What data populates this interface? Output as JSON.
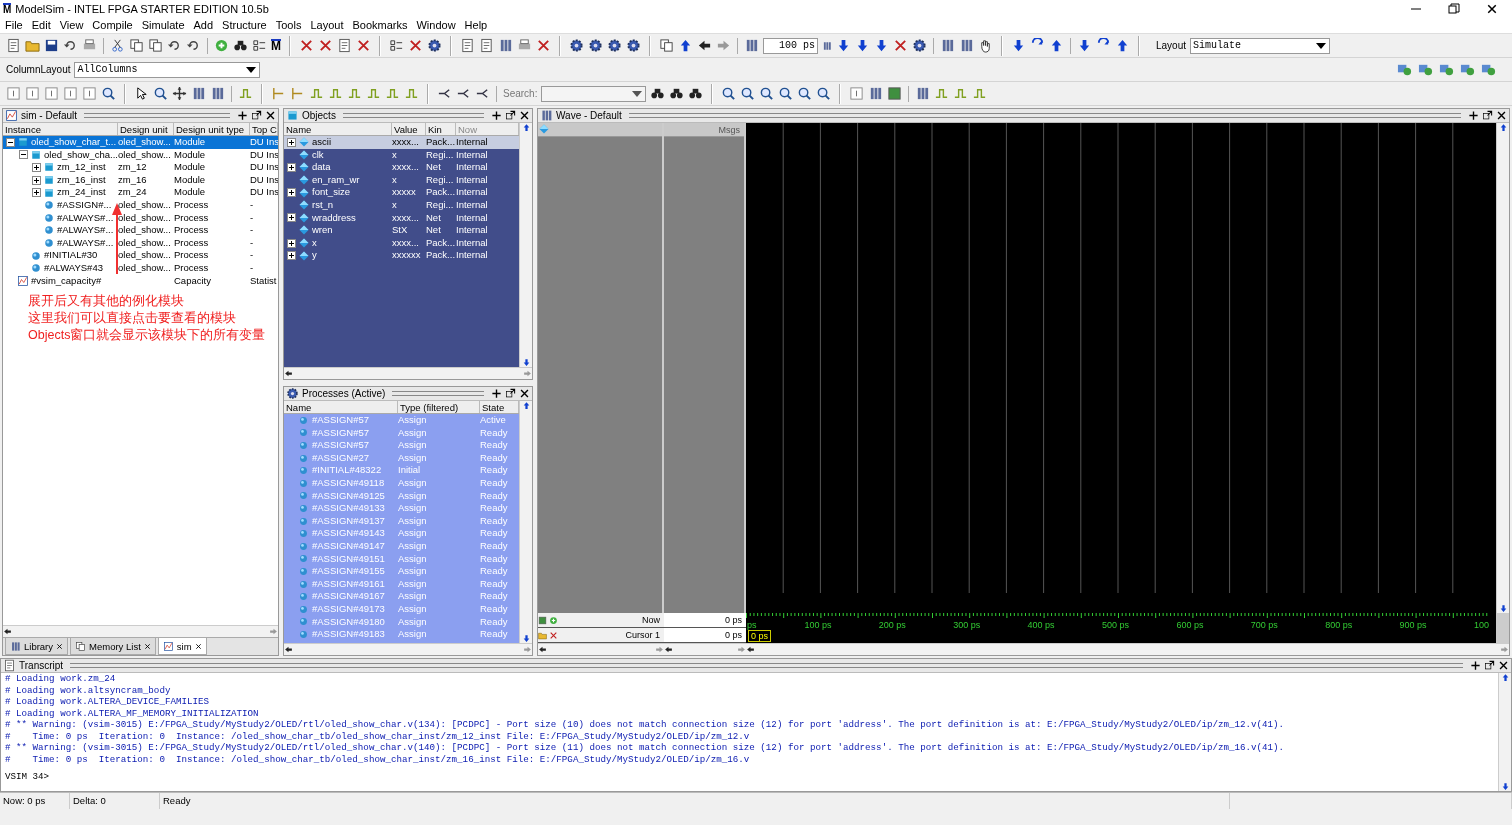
{
  "window": {
    "logo": "M",
    "title": "ModelSim - INTEL FPGA STARTER EDITION 10.5b"
  },
  "menu": [
    "File",
    "Edit",
    "View",
    "Compile",
    "Simulate",
    "Add",
    "Structure",
    "Tools",
    "Layout",
    "Bookmarks",
    "Window",
    "Help"
  ],
  "toolbar": {
    "logo": "M",
    "run_length": "100 ps",
    "layout_label": "Layout",
    "layout_value": "Simulate",
    "column_layout_label": "ColumnLayout",
    "column_layout_value": "AllColumns",
    "search_label": "Search:"
  },
  "sim": {
    "title": "sim - Default",
    "columns": [
      "Instance",
      "Design unit",
      "Design unit type",
      "Top C"
    ],
    "items": [
      {
        "kind": "module",
        "name": "oled_show_char_t...",
        "unit": "oled_show...",
        "type": "Module",
        "top": "DU Ins",
        "selected": true,
        "expanded": true,
        "children": [
          {
            "kind": "module",
            "name": "oled_show_cha...",
            "unit": "oled_show...",
            "type": "Module",
            "top": "DU Ins",
            "selected": false,
            "expanded": true,
            "children": [
              {
                "kind": "module",
                "name": "zm_12_inst",
                "unit": "zm_12",
                "type": "Module",
                "top": "DU Ins",
                "selected": false,
                "expanded": false
              },
              {
                "kind": "module",
                "name": "zm_16_inst",
                "unit": "zm_16",
                "type": "Module",
                "top": "DU Ins",
                "selected": false,
                "expanded": false
              },
              {
                "kind": "module",
                "name": "zm_24_inst",
                "unit": "zm_24",
                "type": "Module",
                "top": "DU Ins",
                "selected": false,
                "expanded": false
              },
              {
                "kind": "process",
                "name": "#ASSIGN#...",
                "unit": "oled_show...",
                "type": "Process",
                "top": "-",
                "selected": false
              },
              {
                "kind": "process",
                "name": "#ALWAYS#...",
                "unit": "oled_show...",
                "type": "Process",
                "top": "-",
                "selected": false
              },
              {
                "kind": "process",
                "name": "#ALWAYS#...",
                "unit": "oled_show...",
                "type": "Process",
                "top": "-",
                "selected": false
              },
              {
                "kind": "process",
                "name": "#ALWAYS#...",
                "unit": "oled_show...",
                "type": "Process",
                "top": "-",
                "selected": false
              }
            ]
          },
          {
            "kind": "process",
            "name": "#INITIAL#30",
            "unit": "oled_show...",
            "type": "Process",
            "top": "-",
            "selected": false
          },
          {
            "kind": "process",
            "name": "#ALWAYS#43",
            "unit": "oled_show...",
            "type": "Process",
            "top": "-",
            "selected": false
          }
        ]
      },
      {
        "kind": "capacity",
        "name": "#vsim_capacity#",
        "type": "Capacity",
        "top": "Statist",
        "selected": false
      }
    ],
    "note": [
      "展开后又有其他的例化模块",
      "这里我们可以直接点击要查看的模块",
      "Objects窗口就会显示该模块下的所有变量"
    ],
    "tabs": [
      {
        "label": "Library",
        "selected": false
      },
      {
        "label": "Memory List",
        "selected": false
      },
      {
        "label": "sim",
        "selected": true
      }
    ]
  },
  "objects": {
    "title": "Objects",
    "columns": [
      "Name",
      "Value",
      "Kin",
      "Now"
    ],
    "rows": [
      {
        "kind": "vector",
        "name": "ascii",
        "value": "xxxx...",
        "type": "Pack...",
        "mode": "Internal",
        "selected": true
      },
      {
        "kind": "scalar",
        "name": "clk",
        "value": "x",
        "type": "Regi...",
        "mode": "Internal",
        "selected": false
      },
      {
        "kind": "vector",
        "name": "data",
        "value": "xxxx...",
        "type": "Net",
        "mode": "Internal",
        "selected": false
      },
      {
        "kind": "scalar",
        "name": "en_ram_wr",
        "value": "x",
        "type": "Regi...",
        "mode": "Internal",
        "selected": false
      },
      {
        "kind": "vector",
        "name": "font_size",
        "value": "xxxxx",
        "type": "Pack...",
        "mode": "Internal",
        "selected": false
      },
      {
        "kind": "scalar",
        "name": "rst_n",
        "value": "x",
        "type": "Regi...",
        "mode": "Internal",
        "selected": false
      },
      {
        "kind": "vector",
        "name": "wraddress",
        "value": "xxxx...",
        "type": "Net",
        "mode": "Internal",
        "selected": false
      },
      {
        "kind": "scalar",
        "name": "wren",
        "value": "StX",
        "type": "Net",
        "mode": "Internal",
        "selected": false
      },
      {
        "kind": "vector",
        "name": "x",
        "value": "xxxx...",
        "type": "Pack...",
        "mode": "Internal",
        "selected": false
      },
      {
        "kind": "vector",
        "name": "y",
        "value": "xxxxxx",
        "type": "Pack...",
        "mode": "Internal",
        "selected": false
      }
    ]
  },
  "processes": {
    "title": "Processes (Active)",
    "columns": [
      "Name",
      "Type (filtered)",
      "State"
    ],
    "rows": [
      {
        "name": "#ASSIGN#57",
        "type": "Assign",
        "state": "Active"
      },
      {
        "name": "#ASSIGN#57",
        "type": "Assign",
        "state": "Ready"
      },
      {
        "name": "#ASSIGN#57",
        "type": "Assign",
        "state": "Ready"
      },
      {
        "name": "#ASSIGN#27",
        "type": "Assign",
        "state": "Ready"
      },
      {
        "name": "#INITIAL#48322",
        "type": "Initial",
        "state": "Ready"
      },
      {
        "name": "#ASSIGN#49118",
        "type": "Assign",
        "state": "Ready"
      },
      {
        "name": "#ASSIGN#49125",
        "type": "Assign",
        "state": "Ready"
      },
      {
        "name": "#ASSIGN#49133",
        "type": "Assign",
        "state": "Ready"
      },
      {
        "name": "#ASSIGN#49137",
        "type": "Assign",
        "state": "Ready"
      },
      {
        "name": "#ASSIGN#49143",
        "type": "Assign",
        "state": "Ready"
      },
      {
        "name": "#ASSIGN#49147",
        "type": "Assign",
        "state": "Ready"
      },
      {
        "name": "#ASSIGN#49151",
        "type": "Assign",
        "state": "Ready"
      },
      {
        "name": "#ASSIGN#49155",
        "type": "Assign",
        "state": "Ready"
      },
      {
        "name": "#ASSIGN#49161",
        "type": "Assign",
        "state": "Ready"
      },
      {
        "name": "#ASSIGN#49167",
        "type": "Assign",
        "state": "Ready"
      },
      {
        "name": "#ASSIGN#49173",
        "type": "Assign",
        "state": "Ready"
      },
      {
        "name": "#ASSIGN#49180",
        "type": "Assign",
        "state": "Ready"
      },
      {
        "name": "#ASSIGN#49183",
        "type": "Assign",
        "state": "Ready"
      }
    ]
  },
  "wave": {
    "title": "Wave - Default",
    "msgs": "Msgs",
    "now_label": "Now",
    "now_value": "0 ps",
    "cursor_label": "Cursor 1",
    "cursor_value": "0 ps",
    "cursor_time": "0 ps",
    "timeline": [
      "ps",
      "100 ps",
      "200 ps",
      "300 ps",
      "400 ps",
      "500 ps",
      "600 ps",
      "700 ps",
      "800 ps",
      "900 ps",
      "100"
    ]
  },
  "transcript": {
    "title": "Transcript",
    "lines": [
      "# Loading work.zm_24",
      "# Loading work.altsyncram_body",
      "# Loading work.ALTERA_DEVICE_FAMILIES",
      "# Loading work.ALTERA_MF_MEMORY_INITIALIZATION",
      "# ** Warning: (vsim-3015) E:/FPGA_Study/MyStudy2/OLED/rtl/oled_show_char.v(134): [PCDPC] - Port size (10) does not match connection size (12) for port 'address'. The port definition is at: E:/FPGA_Study/MyStudy2/OLED/ip/zm_12.v(41).",
      "#    Time: 0 ps  Iteration: 0  Instance: /oled_show_char_tb/oled_show_char_inst/zm_12_inst File: E:/FPGA_Study/MyStudy2/OLED/ip/zm_12.v",
      "# ** Warning: (vsim-3015) E:/FPGA_Study/MyStudy2/OLED/rtl/oled_show_char.v(140): [PCDPC] - Port size (11) does not match connection size (12) for port 'address'. The port definition is at: E:/FPGA_Study/MyStudy2/OLED/ip/zm_16.v(41).",
      "#    Time: 0 ps  Iteration: 0  Instance: /oled_show_char_tb/oled_show_char_inst/zm_16_inst File: E:/FPGA_Study/MyStudy2/OLED/ip/zm_16.v"
    ],
    "prompt": "VSIM 34>"
  },
  "status": {
    "now": "Now: 0 ps",
    "delta": "Delta: 0",
    "state": "Ready"
  }
}
